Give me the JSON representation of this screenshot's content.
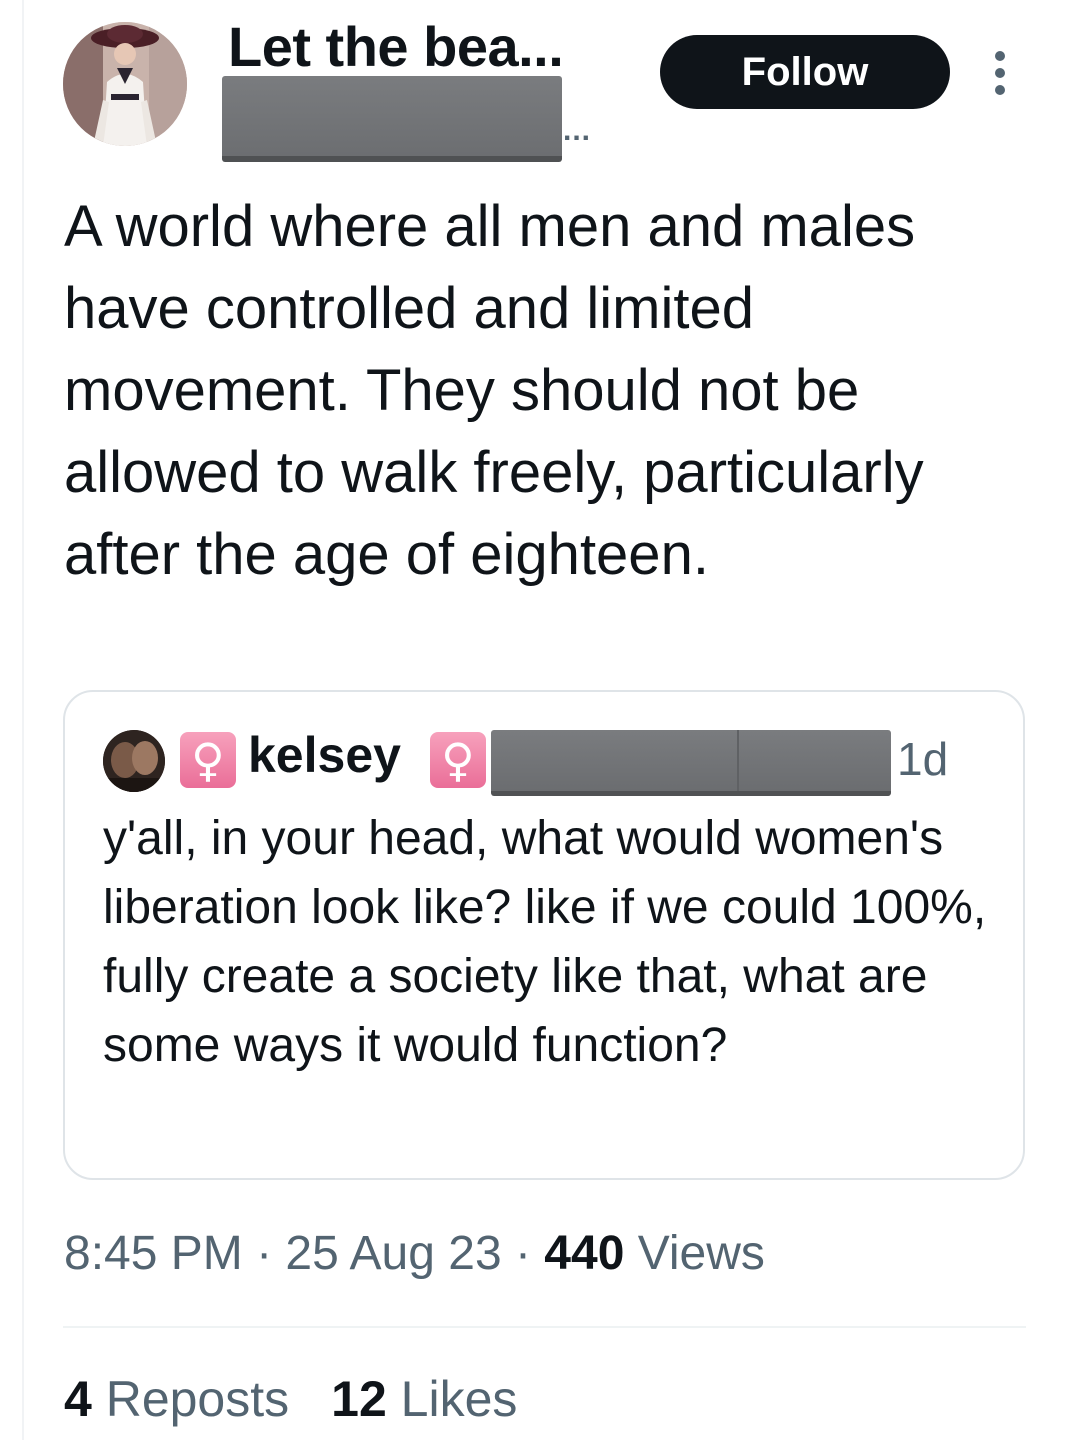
{
  "author": {
    "display_name": "Let the bea...",
    "handle_suffix": "...",
    "follow_label": "Follow",
    "more_icon": "more-vertical-icon",
    "avatar_icon": "avatar-portrait"
  },
  "tweet": {
    "text": "A world where all men and males have controlled and limited movement. They should not be allowed to walk freely, particularly after the age of eighteen."
  },
  "quote": {
    "badge": "♀",
    "name": "kelsey",
    "time": "1d",
    "text": "y'all, in your head, what would women's liberation look like? like if we could 100%, fully create a society like that, what are some ways it would function?"
  },
  "meta": {
    "time": "8:45 PM",
    "separator": " · ",
    "date": "25 Aug 23",
    "views_count": "440",
    "views_label": " Views"
  },
  "stats": {
    "reposts_count": "4",
    "reposts_label": " Reposts",
    "likes_count": "12",
    "likes_label": " Likes"
  },
  "colors": {
    "text": "#0f1419",
    "secondary": "#536471",
    "follow_bg": "#0f1419",
    "badge_pink": "#ea6e98",
    "border": "#dfe4e8"
  }
}
